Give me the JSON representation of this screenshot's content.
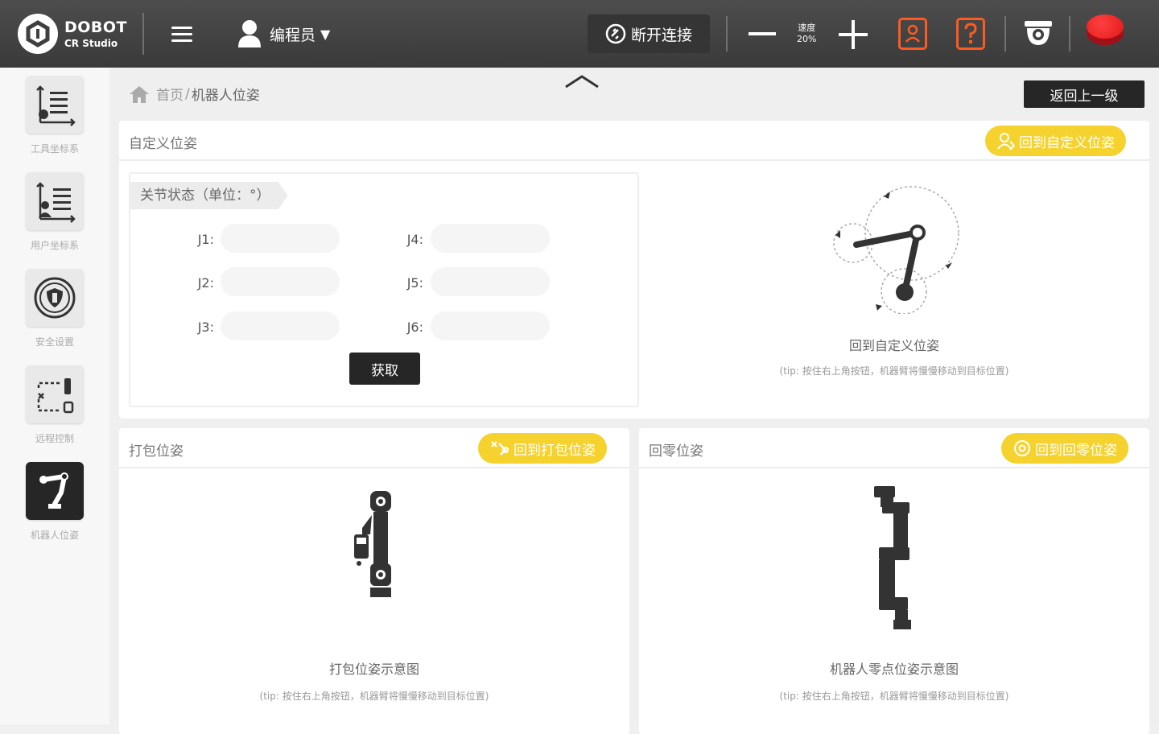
{
  "topbar": {
    "brand": "DOBOT",
    "product": "CR Studio",
    "user_role": "编程员",
    "disconnect_label": "断开连接",
    "speed_label": "速度",
    "speed_value": "20%"
  },
  "sidebar": {
    "items": [
      {
        "label": "工具坐标系",
        "icon": "tool-coordinate-icon"
      },
      {
        "label": "用户坐标系",
        "icon": "user-coordinate-icon"
      },
      {
        "label": "安全设置",
        "icon": "shield-icon"
      },
      {
        "label": "远程控制",
        "icon": "remote-control-icon"
      },
      {
        "label": "机器人位姿",
        "icon": "robot-arm-icon"
      }
    ]
  },
  "breadcrumb": {
    "home": "首页",
    "separator": "/",
    "current": "机器人位姿"
  },
  "back_button": "返回上一级",
  "custom_pose": {
    "title": "自定义位姿",
    "action": "回到自定义位姿",
    "joint_section_title": "关节状态（单位：°）",
    "joints": [
      {
        "label": "J1:",
        "value": ""
      },
      {
        "label": "J2:",
        "value": ""
      },
      {
        "label": "J3:",
        "value": ""
      },
      {
        "label": "J4:",
        "value": ""
      },
      {
        "label": "J5:",
        "value": ""
      },
      {
        "label": "J6:",
        "value": ""
      }
    ],
    "get_button": "获取",
    "caption": "回到自定义位姿",
    "tip": "(tip: 按住右上角按钮，机器臂将慢慢移动到目标位置)"
  },
  "pack_pose": {
    "title": "打包位姿",
    "action": "回到打包位姿",
    "caption": "打包位姿示意图",
    "tip": "(tip: 按住右上角按钮，机器臂将慢慢移动到目标位置)"
  },
  "zero_pose": {
    "title": "回零位姿",
    "action": "回到回零位姿",
    "caption": "机器人零点位姿示意图",
    "tip": "(tip: 按住右上角按钮，机器臂将慢慢移动到目标位置)"
  },
  "colors": {
    "accent_yellow": "#f5d22e",
    "topbar": "#404040",
    "warning_orange": "#ff5a1f",
    "estop_red": "#e01818"
  }
}
